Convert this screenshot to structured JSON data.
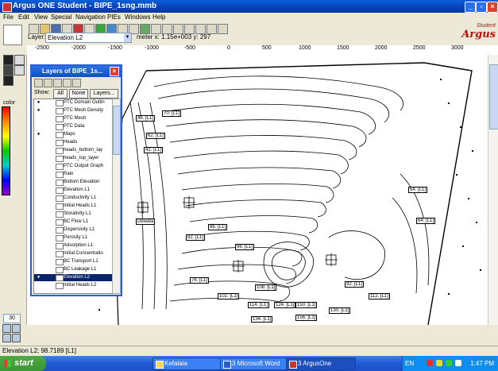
{
  "window": {
    "title": "Argus ONE Student - BIPE_1sng.mmb",
    "controls": [
      "minimize",
      "restore",
      "close"
    ]
  },
  "menu": [
    "File",
    "Edit",
    "View",
    "Special",
    "Navigation",
    "PIEs",
    "Windows",
    "Help"
  ],
  "toolbar": {
    "layer_label": "Layer:",
    "layer_value": "Elevation L2",
    "coords_text": "meter x: 1.15e+003 y: 297"
  },
  "logo": {
    "brand": "Argus",
    "tag": "Student"
  },
  "ruler": {
    "ticks": [
      "-2500",
      "-2000",
      "-1500",
      "-1000",
      "-500",
      "0",
      "500",
      "1000",
      "1500",
      "2000",
      "2500",
      "3000"
    ]
  },
  "palette": {
    "color_label": "color",
    "zoom_value": "30"
  },
  "layers_window": {
    "title": "Layers of BIPE_1s...",
    "show_label": "Show:",
    "buttons": [
      "All",
      "None",
      "Layers..."
    ],
    "layers": [
      {
        "name": "PTC Domain Outlin",
        "visible": true,
        "selected": false
      },
      {
        "name": "PTC Mesh Density",
        "visible": true,
        "selected": false
      },
      {
        "name": "PTC Mesh",
        "visible": false,
        "selected": false
      },
      {
        "name": "PTC Data",
        "visible": false,
        "selected": false
      },
      {
        "name": "Maps",
        "visible": true,
        "selected": false
      },
      {
        "name": "Heads",
        "visible": false,
        "selected": false
      },
      {
        "name": "heads_bottom_lay",
        "visible": false,
        "selected": false
      },
      {
        "name": "heads_top_layer",
        "visible": false,
        "selected": false
      },
      {
        "name": "PTC Output Graph",
        "visible": false,
        "selected": false
      },
      {
        "name": "Rain",
        "visible": false,
        "selected": false
      },
      {
        "name": "Bottom Elevation",
        "visible": false,
        "selected": false
      },
      {
        "name": "Elevation L1",
        "visible": false,
        "selected": false
      },
      {
        "name": "Conductivity L1",
        "visible": false,
        "selected": false
      },
      {
        "name": "Initial Heads L1",
        "visible": false,
        "selected": false
      },
      {
        "name": "Storativity L1",
        "visible": false,
        "selected": false
      },
      {
        "name": "BC Flow L1",
        "visible": false,
        "selected": false
      },
      {
        "name": "Dispersivity L1",
        "visible": false,
        "selected": false
      },
      {
        "name": "Porosity L1",
        "visible": false,
        "selected": false
      },
      {
        "name": "Adsorption L1",
        "visible": false,
        "selected": false
      },
      {
        "name": "Initial Concentratio",
        "visible": false,
        "selected": false
      },
      {
        "name": "BC Transport L1",
        "visible": false,
        "selected": false
      },
      {
        "name": "BC Leakage L1",
        "visible": false,
        "selected": false
      },
      {
        "name": "Elevation L2",
        "visible": true,
        "selected": true
      },
      {
        "name": "Initial Heads L2",
        "visible": false,
        "selected": false
      }
    ]
  },
  "map_labels": [
    "70. [L1]",
    "46. [L1]",
    "42. [L1]",
    "62. [L1]",
    "64. [L1]",
    "64. [L1]",
    "Dewata",
    "82. [L1]",
    "86. [L1]",
    "96. [L1]",
    "108. [L1]",
    "114. [L1]",
    "124. [L1]",
    "134. [L1]",
    "150. [L1]",
    "92. [L1]",
    "112. [L1]",
    "156. [L1]",
    "76. [L1]",
    "102. [L1]",
    "130. [L1]"
  ],
  "status": {
    "text": "Elevation L2; 98.7189 [L1]"
  },
  "taskbar": {
    "start_label": "start",
    "items": [
      "Kefalaia",
      "3 Microsoft Word",
      "3 ArgusOne"
    ],
    "language": "EN",
    "clock": "1:47 PM"
  }
}
